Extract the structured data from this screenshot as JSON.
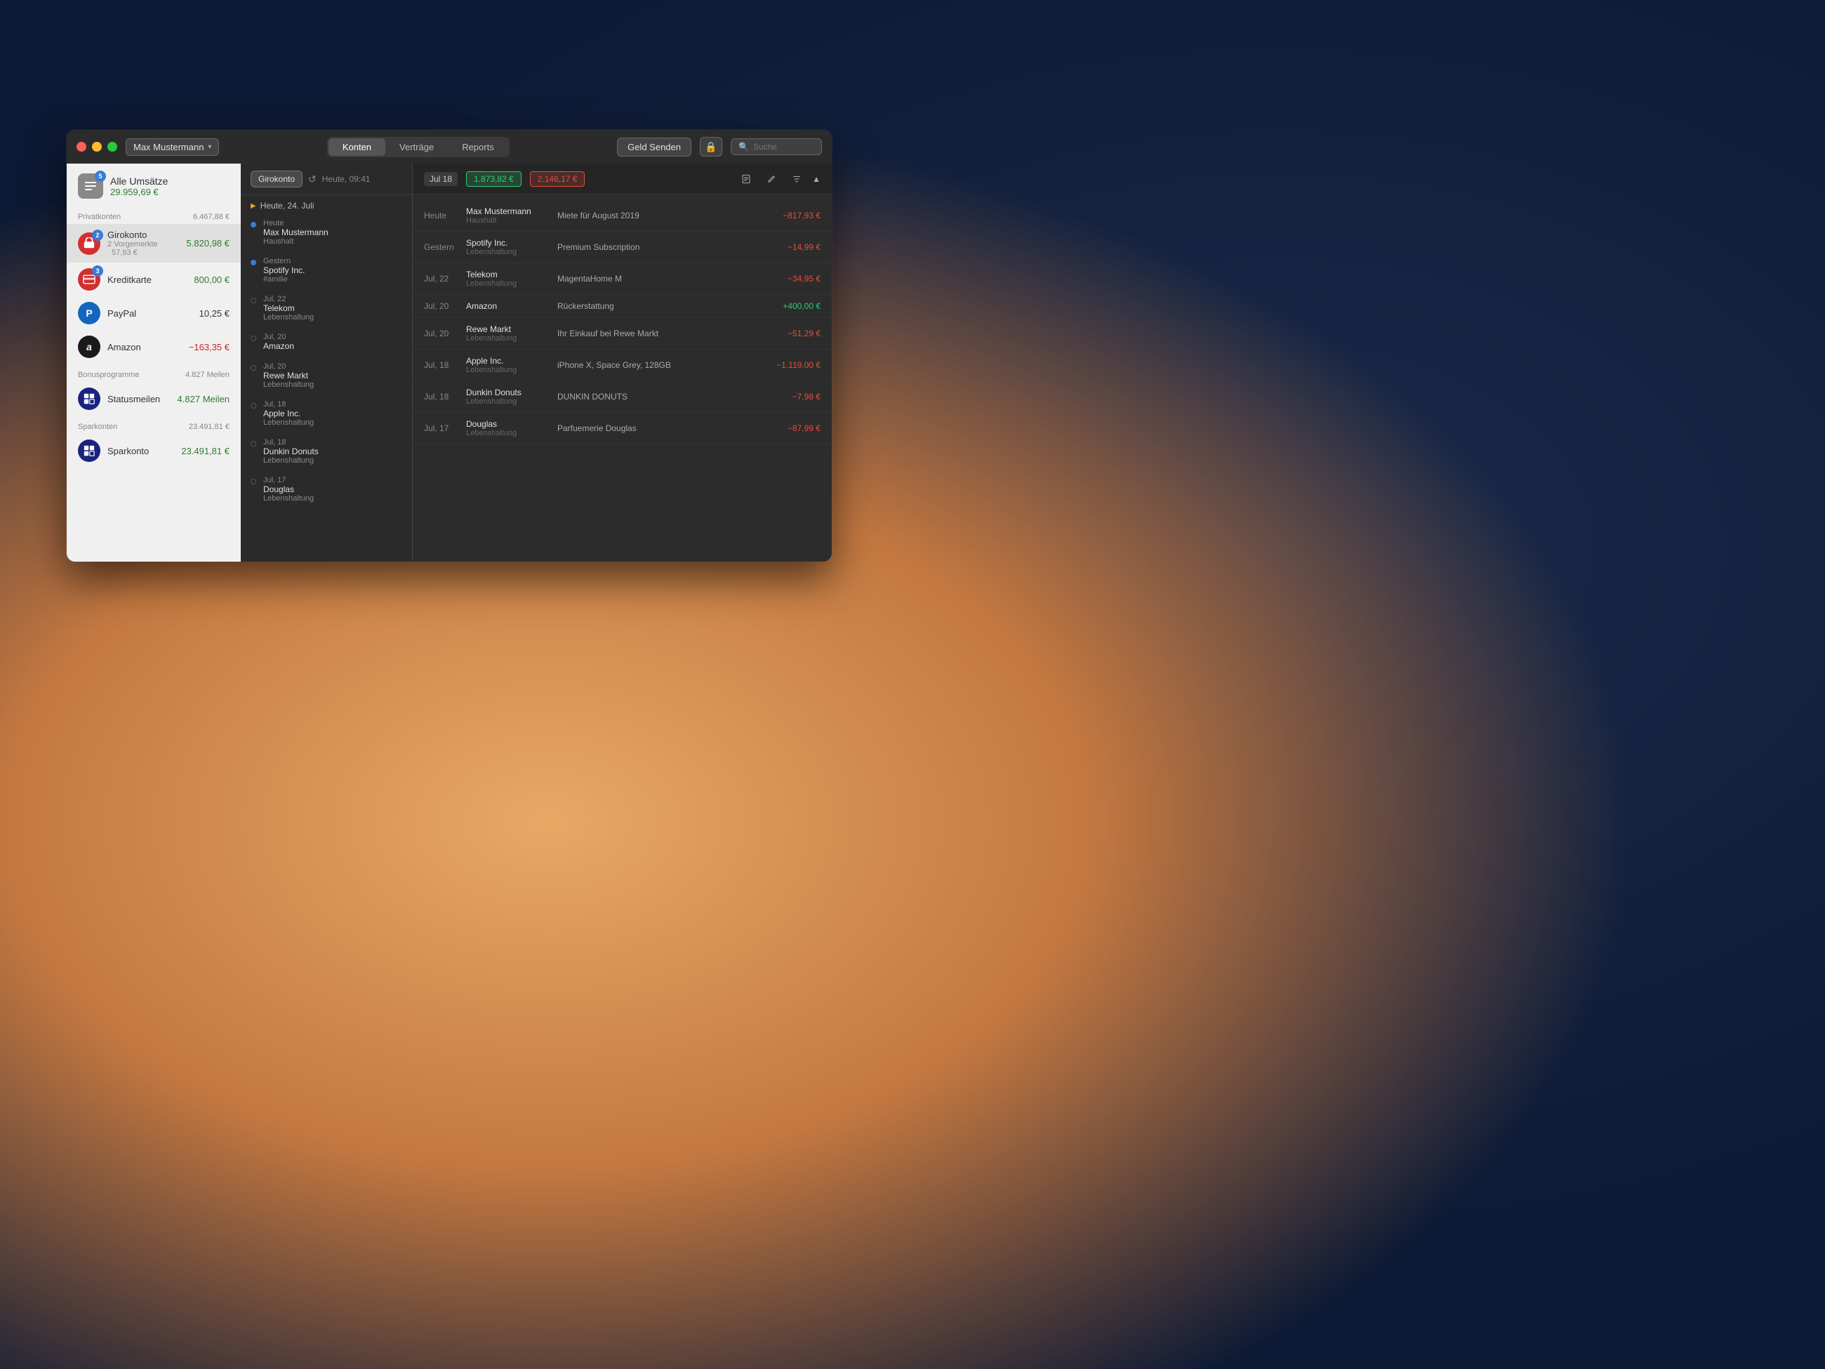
{
  "desktop": {},
  "window": {
    "title": "Max Mustermann",
    "user": "Max Mustermann",
    "user_chevron": "▾"
  },
  "titlebar": {
    "tabs": [
      {
        "id": "konten",
        "label": "Konten",
        "active": true
      },
      {
        "id": "vertraege",
        "label": "Verträge",
        "active": false
      },
      {
        "id": "reports",
        "label": "Reports",
        "active": false
      }
    ],
    "send_button": "Geld Senden",
    "search_placeholder": "Suche"
  },
  "sidebar": {
    "all_transactions_label": "Alle Umsätze",
    "all_transactions_amount": "29.959,69 €",
    "all_transactions_badge": "5",
    "sections": [
      {
        "header": "Privatkonten",
        "header_amount": "6.467,88 €",
        "accounts": [
          {
            "name": "Girokonto",
            "icon": "🏦",
            "color": "red",
            "amount": "5.820,98 €",
            "amount_color": "green",
            "sub": "2 Vorgemerkte",
            "sub_amount": "57,93 €",
            "badge": "2",
            "selected": true
          },
          {
            "name": "Kreditkarte",
            "icon": "💳",
            "color": "red2",
            "amount": "800,00 €",
            "amount_color": "green",
            "badge": "3"
          },
          {
            "name": "PayPal",
            "icon": "P",
            "color": "blue",
            "amount": "10,25 €",
            "amount_color": "black"
          },
          {
            "name": "Amazon",
            "icon": "a",
            "color": "black",
            "amount": "−163,35 €",
            "amount_color": "red"
          }
        ]
      },
      {
        "header": "Bonusprogramme",
        "header_amount": "4.827 Meilen",
        "accounts": [
          {
            "name": "Statusmeilen",
            "icon": "◧",
            "color": "dark-blue",
            "amount": "4.827 Meilen",
            "amount_color": "miles"
          }
        ]
      },
      {
        "header": "Sparkonten",
        "header_amount": "23.491,81 €",
        "accounts": [
          {
            "name": "Sparkonto",
            "icon": "◧",
            "color": "dark-blue",
            "amount": "23.491,81 €",
            "amount_color": "green"
          }
        ]
      }
    ]
  },
  "transaction_panel": {
    "account_button": "Girokonto",
    "date_shown": "Heute, 09:41",
    "group_header": "Heute, 24. Juli",
    "items": [
      {
        "dot": true,
        "date": "Heute",
        "payee": "Max Mustermann",
        "category": "Haushalt"
      },
      {
        "dot": true,
        "date": "Gestern",
        "payee": "Spotify Inc.",
        "category": "#amilie"
      },
      {
        "dot": false,
        "date": "Jul, 22",
        "payee": "Telekom",
        "category": "Lebenshaltung"
      },
      {
        "dot": false,
        "date": "Jul, 20",
        "payee": "Amazon",
        "category": ""
      },
      {
        "dot": false,
        "date": "Jul, 20",
        "payee": "Rewe Markt",
        "category": "Lebenshaltung"
      },
      {
        "dot": false,
        "date": "Jul, 18",
        "payee": "Apple Inc.",
        "category": "Lebenshaltung"
      },
      {
        "dot": false,
        "date": "Jul, 18",
        "payee": "Dunkin Donuts",
        "category": "Lebenshaltung"
      },
      {
        "dot": false,
        "date": "Jul, 17",
        "payee": "Douglas",
        "category": "Lebenshaltung"
      }
    ]
  },
  "detail_panel": {
    "month_label": "Jul 18",
    "balance_positive": "1.873,82 €",
    "balance_negative": "2.146,17 €",
    "transactions": [
      {
        "date": "Heute",
        "payee": "Max Mustermann",
        "category": "Haushalt",
        "description": "Miete für August 2019",
        "amount": "−817,93 €",
        "amount_type": "negative"
      },
      {
        "date": "Gestern",
        "payee": "Spotify Inc.",
        "category": "Lebenshaltung",
        "description": "Premium Subscription",
        "amount": "−14,99 €",
        "amount_type": "negative"
      },
      {
        "date": "Jul, 22",
        "payee": "Telekom",
        "category": "Lebenshaltung",
        "description": "MagentaHome M",
        "amount": "−34,95 €",
        "amount_type": "negative"
      },
      {
        "date": "Jul, 20",
        "payee": "Amazon",
        "category": "",
        "description": "Rückerstattung",
        "amount": "+400,00 €",
        "amount_type": "positive"
      },
      {
        "date": "Jul, 20",
        "payee": "Rewe Markt",
        "category": "Lebenshaltung",
        "description": "Ihr Einkauf bei Rewe Markt",
        "amount": "−51,29 €",
        "amount_type": "negative"
      },
      {
        "date": "Jul, 18",
        "payee": "Apple Inc.",
        "category": "Lebenshaltung",
        "description": "iPhone X, Space Grey, 128GB",
        "amount": "−1.119,00 €",
        "amount_type": "negative"
      },
      {
        "date": "Jul, 18",
        "payee": "Dunkin Donuts",
        "category": "Lebenshaltung",
        "description": "DUNKIN DONUTS",
        "amount": "−7,98 €",
        "amount_type": "negative"
      },
      {
        "date": "Jul, 17",
        "payee": "Douglas",
        "category": "Lebenshaltung",
        "description": "Parfuemerie Douglas",
        "amount": "−87,99 €",
        "amount_type": "negative"
      }
    ]
  }
}
